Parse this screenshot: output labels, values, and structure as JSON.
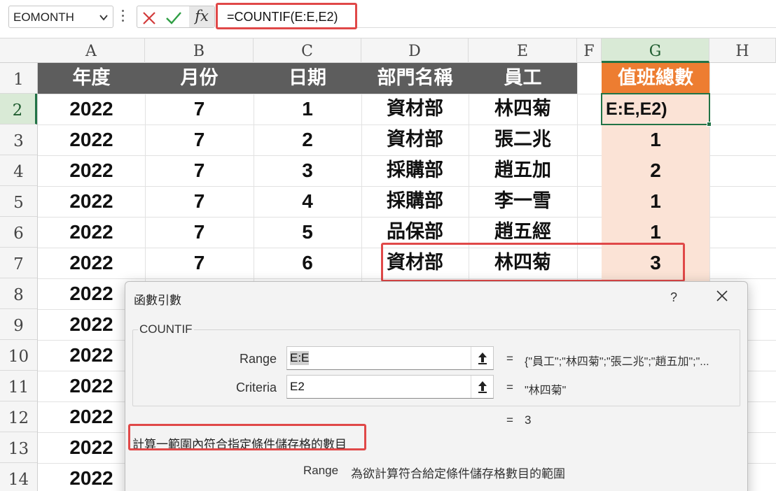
{
  "formula_bar": {
    "name_box": "EOMONTH",
    "fx_label": "fx",
    "formula": "=COUNTIF(E:E,E2)"
  },
  "columns": [
    "A",
    "B",
    "C",
    "D",
    "E",
    "F",
    "G",
    "H"
  ],
  "rows": [
    "1",
    "2",
    "3",
    "4",
    "5",
    "6",
    "7",
    "8",
    "9",
    "10",
    "11",
    "12",
    "13",
    "14"
  ],
  "table": {
    "headers": {
      "A": "年度",
      "B": "月份",
      "C": "日期",
      "D": "部門名稱",
      "E": "員工",
      "G": "值班總數"
    },
    "data": [
      {
        "A": "2022",
        "B": "7",
        "C": "1",
        "D": "資材部",
        "E": "林四菊",
        "G": "E:E,E2)"
      },
      {
        "A": "2022",
        "B": "7",
        "C": "2",
        "D": "資材部",
        "E": "張二兆",
        "G": "1"
      },
      {
        "A": "2022",
        "B": "7",
        "C": "3",
        "D": "採購部",
        "E": "趙五加",
        "G": "2"
      },
      {
        "A": "2022",
        "B": "7",
        "C": "4",
        "D": "採購部",
        "E": "李一雪",
        "G": "1"
      },
      {
        "A": "2022",
        "B": "7",
        "C": "5",
        "D": "品保部",
        "E": "趙五經",
        "G": "1"
      },
      {
        "A": "2022",
        "B": "7",
        "C": "6",
        "D": "資材部",
        "E": "林四菊",
        "G": "3"
      }
    ],
    "col_a_rest": [
      "2022",
      "2022",
      "2022",
      "2022",
      "2022",
      "2022",
      "2022"
    ]
  },
  "dialog": {
    "title": "函數引數",
    "help": "?",
    "function_name": "COUNTIF",
    "args": [
      {
        "label": "Range",
        "value": "E:E",
        "result": "{\"員工\";\"林四菊\";\"張二兆\";\"趙五加\";\"..."
      },
      {
        "label": "Criteria",
        "value": "E2",
        "result": "\"林四菊\""
      }
    ],
    "equals": "=",
    "formula_result": "3",
    "description": "計算一範圍內符合指定條件儲存格的數目",
    "param_name": "Range",
    "param_description": "為欲計算符合給定條件儲存格數目的範圍"
  },
  "colors": {
    "header_band": "#5d5d5d",
    "header_accent": "#ed7d31",
    "result_fill": "#fbe3d6",
    "selection": "#217346",
    "callout": "#e04848"
  }
}
